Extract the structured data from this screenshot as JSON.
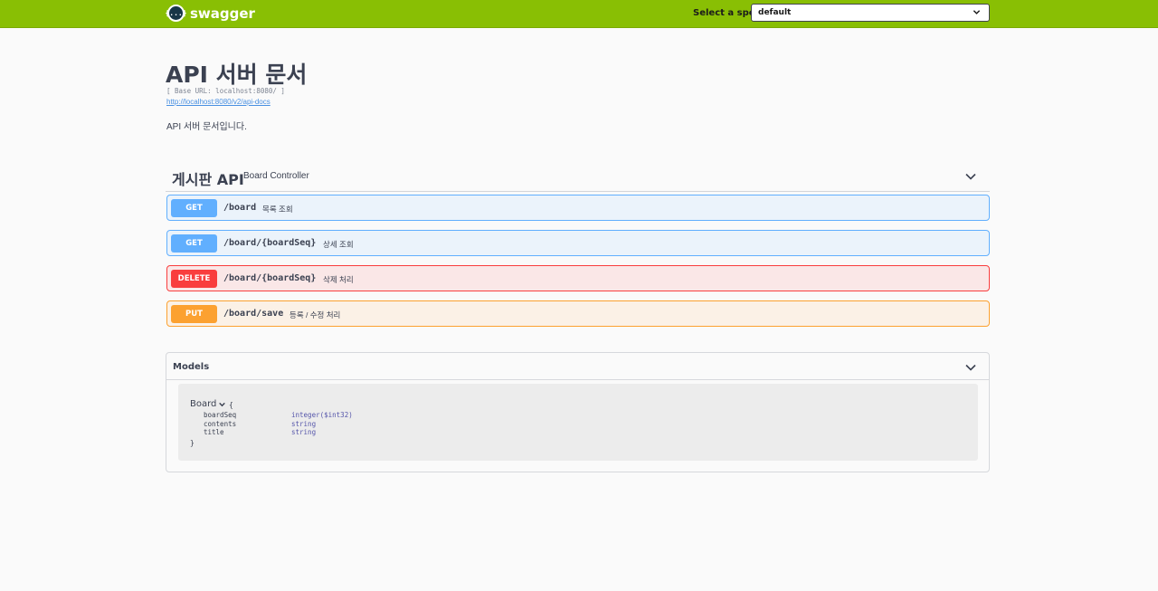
{
  "topbar": {
    "logo_glyph": "{...}",
    "brand": "swagger",
    "spec_label": "Select a spec",
    "spec_value": "default",
    "bg_color": "#89bf04"
  },
  "info": {
    "title": "API 서버 문서",
    "base_url": "[ Base URL: localhost:8080/ ]",
    "link": "http://localhost:8080/v2/api-docs",
    "description": "API 서버 문서입니다."
  },
  "tag": {
    "name": "게시판 API",
    "description": "Board Controller",
    "icon": "chevron-down-icon"
  },
  "operations": [
    {
      "method": "GET",
      "path": "/board",
      "summary": "목록 조회",
      "color": "#61affe"
    },
    {
      "method": "GET",
      "path": "/board/{boardSeq}",
      "summary": "상세 조회",
      "color": "#61affe"
    },
    {
      "method": "DELETE",
      "path": "/board/{boardSeq}",
      "summary": "삭제 처리",
      "color": "#f93e3e"
    },
    {
      "method": "PUT",
      "path": "/board/save",
      "summary": "등록 / 수정 처리",
      "color": "#fca130"
    }
  ],
  "models": {
    "title": "Models",
    "model": {
      "name": "Board",
      "open_brace": "{",
      "close_brace": "}",
      "properties": [
        {
          "name": "boardSeq",
          "type": "integer($int32)"
        },
        {
          "name": "contents",
          "type": "string"
        },
        {
          "name": "title",
          "type": "string"
        }
      ]
    }
  }
}
